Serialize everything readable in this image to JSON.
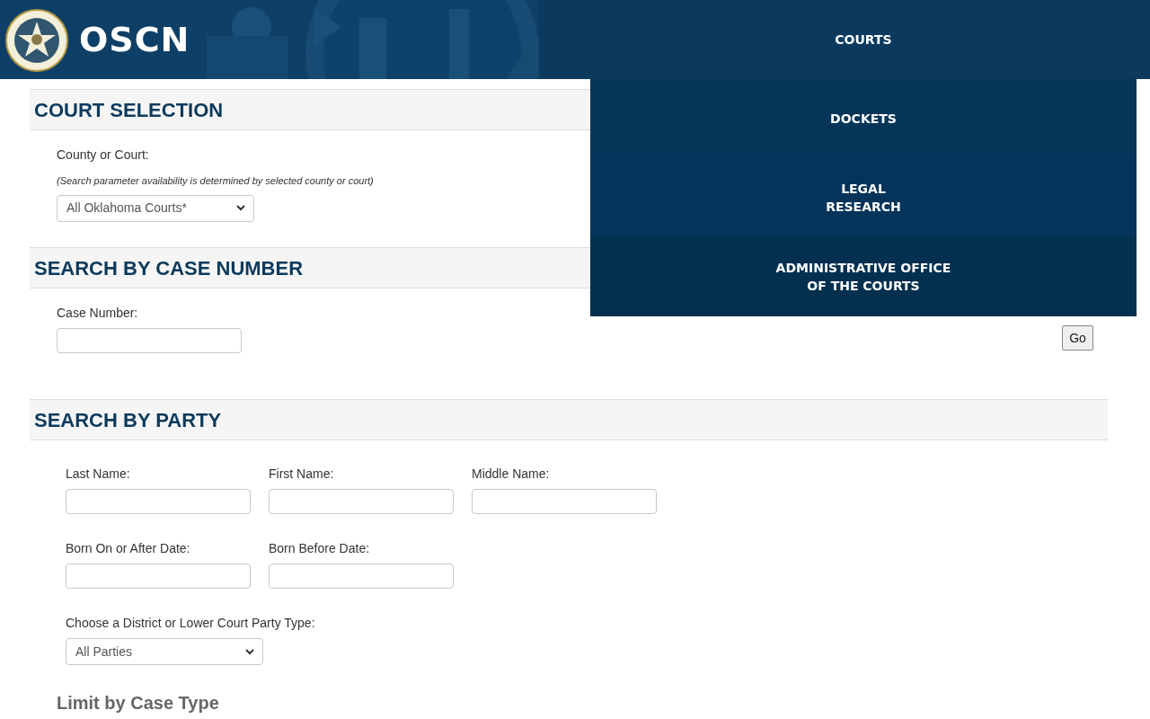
{
  "header": {
    "logo_text": "OSCN"
  },
  "menu": [
    {
      "label": "COURTS"
    },
    {
      "label": "DOCKETS"
    },
    {
      "label": "LEGAL\nRESEARCH"
    },
    {
      "label": "ADMINISTRATIVE OFFICE\nOF THE COURTS"
    }
  ],
  "court_selection": {
    "title": "COURT SELECTION",
    "label": "County or Court:",
    "note": "(Search parameter availability is determined by selected county or court)",
    "select_value": "All Oklahoma Courts*"
  },
  "case_number": {
    "title": "SEARCH BY CASE NUMBER",
    "label": "Case Number:",
    "go_button": "Go"
  },
  "party": {
    "title": "SEARCH BY PARTY",
    "field_rows": [
      [
        {
          "label": "Last Name:"
        },
        {
          "label": "First Name:"
        },
        {
          "label": "Middle Name:"
        }
      ],
      [
        {
          "label": "Born On or After Date:"
        },
        {
          "label": "Born Before Date:"
        }
      ]
    ],
    "party_type_label": "Choose a District or Lower Court Party Type:",
    "party_type_value": "All Parties",
    "limit_title": "Limit by Case Type"
  }
}
